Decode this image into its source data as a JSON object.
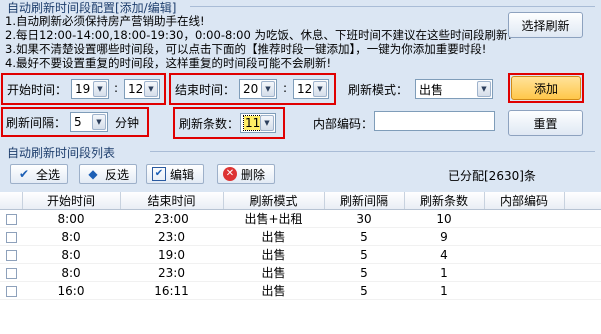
{
  "config_panel": {
    "title": "自动刷新时间段配置[添加/编辑]",
    "notes": [
      "1.自动刷新必须保持房产营销助手在线!",
      "2.每日12:00-14:00,18:00-19:30，0:00-8:00 为吃饭、休息、下班时间不建议在这些时间段刷新!",
      "3.如果不清楚设置哪些时间段，可以点击下面的【推荐时段一键添加】，一键为你添加重要时段!",
      "4.最好不要设置重复的时间段，这样重复的时间段可能不会刷新!"
    ],
    "select_refresh_button": "选择刷新",
    "start_time_label": "开始时间：",
    "start_hour": "19",
    "start_minute": "12",
    "time_separator": ":",
    "end_time_label": "结束时间：",
    "end_hour": "20",
    "end_minute": "12",
    "mode_label": "刷新模式：",
    "mode_value": "出售",
    "add_button": "添加",
    "interval_label": "刷新间隔：",
    "interval_value": "5",
    "interval_unit": "分钟",
    "count_label": "刷新条数：",
    "count_value": "11",
    "internal_code_label": "内部编码：",
    "internal_code_value": "",
    "reset_button": "重置"
  },
  "list_panel": {
    "title": "自动刷新时间段列表",
    "toolbar": {
      "select_all": "全选",
      "invert": "反选",
      "edit": "编辑",
      "delete": "删除"
    },
    "allocated_text": "已分配[2630]条",
    "columns": [
      "",
      "开始时间",
      "结束时间",
      "刷新模式",
      "刷新间隔",
      "刷新条数",
      "内部编码",
      ""
    ],
    "rows": [
      {
        "start": "8:00",
        "end": "23:00",
        "mode": "出售+出租",
        "interval": "30",
        "count": "10",
        "code": ""
      },
      {
        "start": "8:0",
        "end": "23:0",
        "mode": "出售",
        "interval": "5",
        "count": "9",
        "code": ""
      },
      {
        "start": "8:0",
        "end": "19:0",
        "mode": "出售",
        "interval": "5",
        "count": "4",
        "code": ""
      },
      {
        "start": "8:0",
        "end": "23:0",
        "mode": "出售",
        "interval": "5",
        "count": "1",
        "code": ""
      },
      {
        "start": "16:0",
        "end": "16:11",
        "mode": "出售",
        "interval": "5",
        "count": "1",
        "code": ""
      }
    ]
  },
  "colors": {
    "background": "#dbe6f3",
    "highlight_border": "#e00000",
    "add_button": "#ffc74a"
  }
}
